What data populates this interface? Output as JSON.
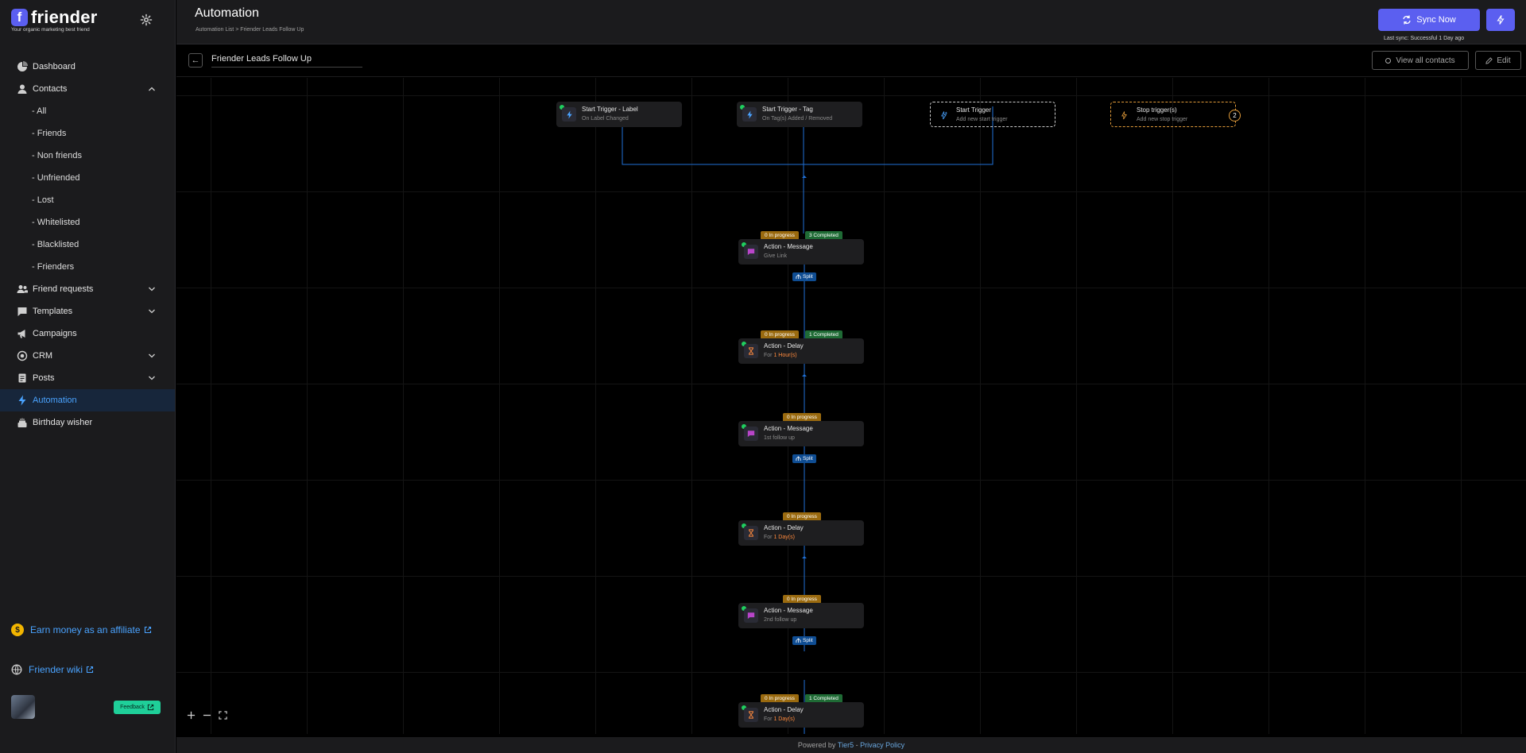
{
  "brand": {
    "logo_letter": "f",
    "name": "friender",
    "tagline": "Your organic marketing best friend"
  },
  "nav": {
    "dashboard": "Dashboard",
    "contacts": "Contacts",
    "contacts_sub": [
      "- All",
      "- Friends",
      "- Non friends",
      "- Unfriended",
      "- Lost",
      "- Whitelisted",
      "- Blacklisted",
      "- Frienders"
    ],
    "friend_requests": "Friend requests",
    "templates": "Templates",
    "campaigns": "Campaigns",
    "crm": "CRM",
    "posts": "Posts",
    "automation": "Automation",
    "birthday": "Birthday wisher"
  },
  "sidebar_footer": {
    "affiliate": "Earn money as an affiliate",
    "affiliate_coin": "$",
    "wiki": "Friender wiki",
    "feedback": "Feedback"
  },
  "header": {
    "title": "Automation",
    "breadcrumb": "Automation List  >  Friender Leads Follow Up",
    "sync_label": "Sync Now",
    "last_sync": "Last sync: Successful 1 Day ago"
  },
  "flow": {
    "name": "Friender Leads Follow  Up",
    "view_contacts": "View all contacts",
    "edit": "Edit",
    "back": "←"
  },
  "triggers": {
    "t1": {
      "title": "Start Trigger - Label",
      "sub": "On Label Changed"
    },
    "t2": {
      "title": "Start Trigger - Tag",
      "sub": "On Tag(s) Added / Removed"
    },
    "t3": {
      "title": "Start Trigger",
      "sub": "Add new start trigger"
    },
    "t4": {
      "title": "Stop trigger(s)",
      "sub": "Add new stop trigger",
      "count": "2"
    }
  },
  "actions": {
    "a1": {
      "title": "Action - Message",
      "sub": "Give Link",
      "progress": "0 In progress",
      "completed": "3 Completed"
    },
    "a2": {
      "title": "Action - Delay",
      "sub_prefix": "For ",
      "sub_hl": "1 Hour(s)",
      "progress": "0 In progress",
      "completed": "1 Completed"
    },
    "a3": {
      "title": "Action - Message",
      "sub": "1st follow up",
      "progress": "0 In progress"
    },
    "a4": {
      "title": "Action - Delay",
      "sub_prefix": "For ",
      "sub_hl": "1 Day(s)",
      "progress": "0 In progress"
    },
    "a5": {
      "title": "Action - Message",
      "sub": "2nd follow up",
      "progress": "0 In progress"
    },
    "a6": {
      "title": "Action - Delay",
      "sub_prefix": "For ",
      "sub_hl": "1 Day(s)",
      "progress": "0 In progress",
      "completed": "1 Completed"
    }
  },
  "split_label": "Split",
  "footer": {
    "prefix": "Powered by ",
    "company": "Tier5",
    "sep": " - ",
    "privacy": "Privacy Policy"
  },
  "icons": {
    "settings": "gear-icon",
    "sync": "sync-icon",
    "bolt": "bolt-icon",
    "message": "chat-icon",
    "delay": "hourglass-icon",
    "trigger": "bolt-icon"
  },
  "colors": {
    "accent": "#5b5ff0",
    "link": "#4aa3ff",
    "progress": "#9a6a0f",
    "completed": "#1f6b35",
    "split": "#0f4d93",
    "connector": "#1f6fd6",
    "stop": "#e39c3a"
  }
}
